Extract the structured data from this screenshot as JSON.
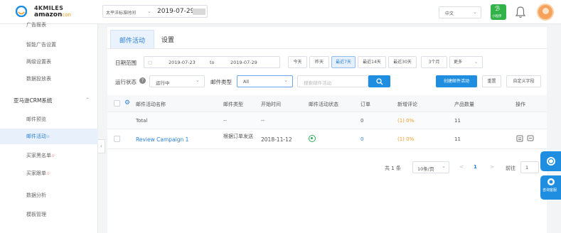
{
  "header": {
    "logo_line1": "4KMILES",
    "logo_line2": "amazon",
    "logo_suffix": "con",
    "timezone": "太平洋标准时间",
    "date": "2019-07-29",
    "language": "中文",
    "mini_program": "小程序"
  },
  "sidebar": {
    "items": [
      {
        "label": "广告报表"
      },
      {
        "label": "智能广告设置"
      },
      {
        "label": "两级设置表"
      },
      {
        "label": "数据投放表"
      },
      {
        "label": "亚马逊CRM系统"
      },
      {
        "label": "邮件预览"
      },
      {
        "label": "邮件活动"
      },
      {
        "label": "买家黑名单"
      },
      {
        "label": "买家跟单"
      },
      {
        "label": "数据分析"
      },
      {
        "label": "模板管理"
      }
    ],
    "new_badge": "☆"
  },
  "tabs": [
    {
      "label": "邮件活动"
    },
    {
      "label": "设置"
    }
  ],
  "filters": {
    "date_label": "日期范围",
    "date_from": "2019-07-23",
    "to": "to",
    "date_to": "2019-07-29",
    "quick": [
      "今天",
      "昨天",
      "最近7天",
      "最近14天",
      "最近30天",
      "3个月",
      "更多"
    ],
    "status_label": "运行状态",
    "status_value": "运行中",
    "type_label": "邮件类型",
    "type_value": "All",
    "search_placeholder": "搜索邮件活动",
    "create_button": "创建邮件活动",
    "reset_button": "重置",
    "custom_button": "自定义字段"
  },
  "table": {
    "headers": [
      "邮件活动名称",
      "邮件类型",
      "开始时间",
      "邮件活动状态",
      "订单",
      "新增评论",
      "产品数量",
      "操作"
    ],
    "rows": [
      {
        "name": "Total",
        "type": "--",
        "start": "--",
        "status": "",
        "orders": "0",
        "reviews": "(1) 0%",
        "products": "11"
      },
      {
        "name": "Review Campaign 1",
        "type": "根据订单发送",
        "start": "2018-11-12",
        "status": "",
        "orders": "0",
        "reviews": "(1) 0%",
        "products": "11"
      }
    ]
  },
  "pagination": {
    "total": "共 1 条",
    "page_size": "10条/页",
    "prev": "<",
    "page": "1",
    "next": ">",
    "goto_label": "前往",
    "goto_value": "1"
  },
  "float": {
    "label": "咨询客服"
  }
}
